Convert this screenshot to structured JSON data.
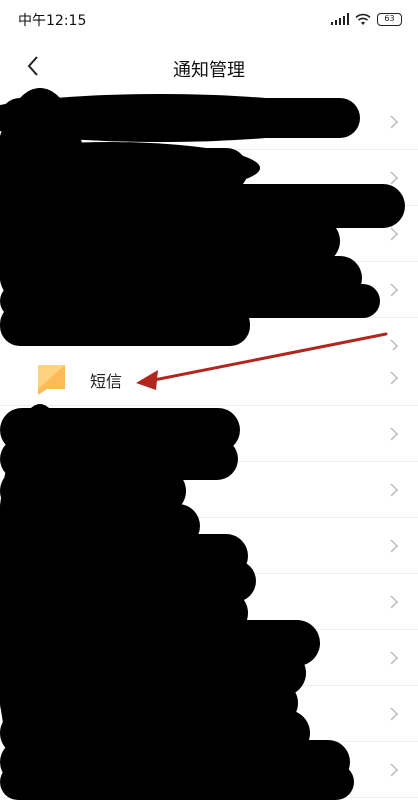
{
  "status_bar": {
    "time": "中午12:15",
    "battery": "63"
  },
  "header": {
    "title": "通知管理",
    "back_icon": "back-chevron-icon"
  },
  "list": {
    "items": [
      {
        "label": ""
      },
      {
        "label": ""
      },
      {
        "label": ""
      },
      {
        "label": ""
      },
      {
        "label": ""
      },
      {
        "label": "短信",
        "icon": "sms-app-icon",
        "icon_color": "#FDBA58"
      },
      {
        "label": ""
      },
      {
        "label": ""
      },
      {
        "label": ""
      },
      {
        "label": ""
      },
      {
        "label": ""
      },
      {
        "label": ""
      },
      {
        "label": ""
      }
    ]
  },
  "annotation": {
    "arrow_color": "#B3261E",
    "redaction_color": "#000000"
  }
}
